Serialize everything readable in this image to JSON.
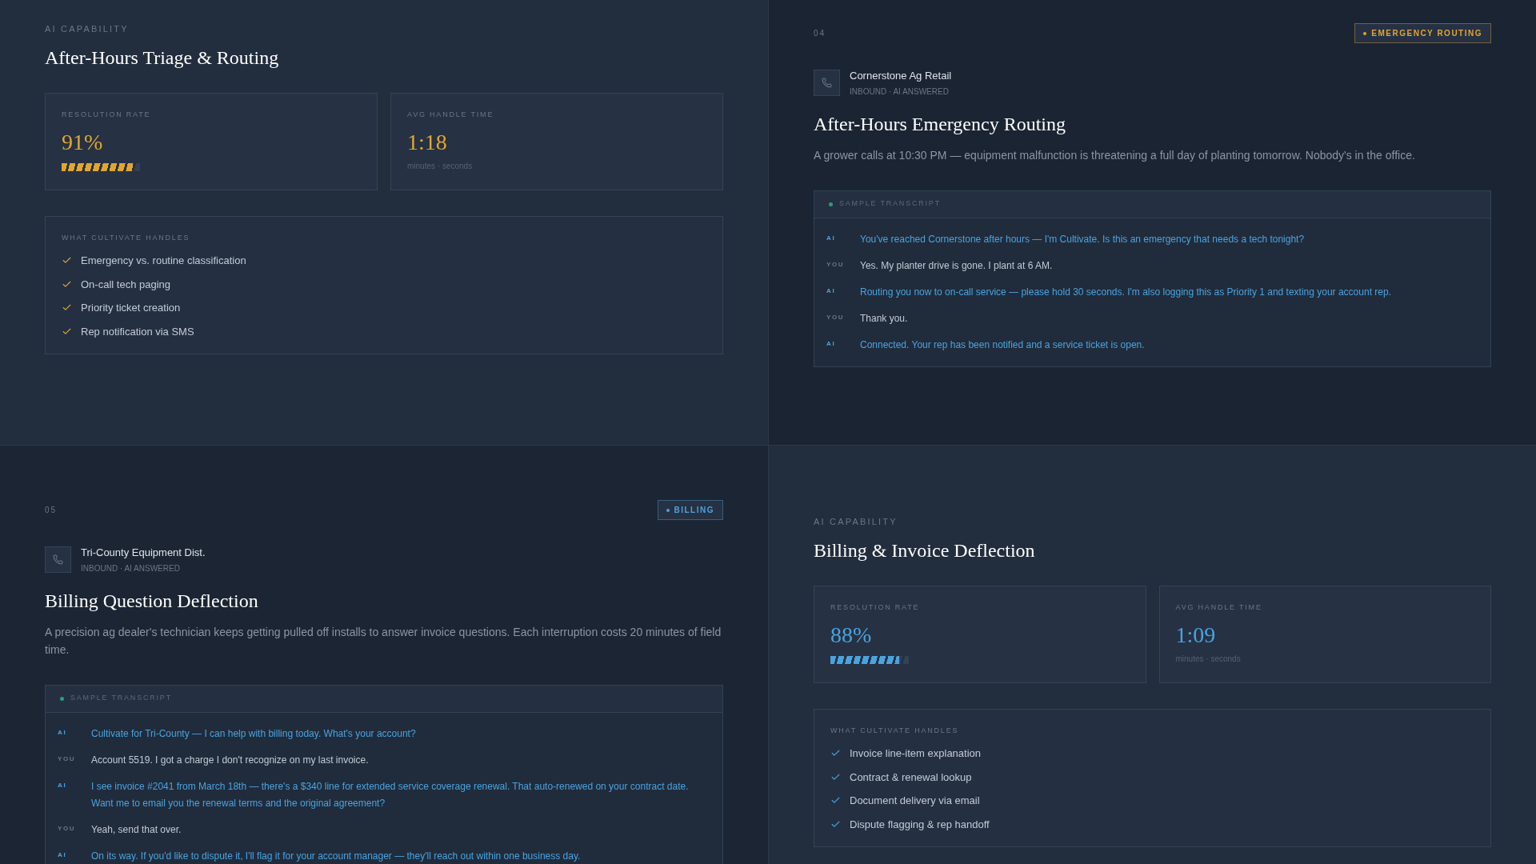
{
  "panels": [
    {
      "kind": "capability",
      "color": "#e0a630",
      "eyebrow": "AI CAPABILITY",
      "title": "After-Hours Triage & Routing",
      "metrics": [
        {
          "kind": "rate",
          "label": "RESOLUTION RATE",
          "value": "91%",
          "level": 0.91
        },
        {
          "kind": "time",
          "label": "AVG HANDLE TIME",
          "value": "1:18",
          "caption": "minutes · seconds"
        }
      ],
      "handles": {
        "heading": "WHAT CULTIVATE HANDLES",
        "items": [
          "Emergency vs. routine classification",
          "On-call tech paging",
          "Priority ticket creation",
          "Rep notification via SMS"
        ]
      }
    },
    {
      "kind": "scenario",
      "color": "#e0a630",
      "number": "04",
      "badge": "EMERGENCY ROUTING",
      "caller": {
        "name": "Cornerstone Ag Retail",
        "meta": "INBOUND · AI ANSWERED"
      },
      "title": "After-Hours Emergency Routing",
      "description": "A grower calls at 10:30 PM — equipment malfunction is threatening a full day of planting tomorrow. Nobody's in the office.",
      "transcript": {
        "heading": "SAMPLE TRANSCRIPT",
        "lines": [
          {
            "kind": "ai",
            "speaker": "AI",
            "text": "You've reached Cornerstone after hours — I'm Cultivate. Is this an emergency that needs a tech tonight?"
          },
          {
            "kind": "user",
            "speaker": "YOU",
            "text": "Yes. My planter drive is gone. I plant at 6 AM."
          },
          {
            "kind": "ai",
            "speaker": "AI",
            "text": "Routing you now to on-call service — please hold 30 seconds. I'm also logging this as Priority 1 and texting your account rep."
          },
          {
            "kind": "user",
            "speaker": "YOU",
            "text": "Thank you."
          },
          {
            "kind": "ai",
            "speaker": "AI",
            "text": "Connected. Your rep has been notified and a service ticket is open."
          }
        ]
      }
    },
    {
      "kind": "scenario",
      "color": "#4aa3df",
      "number": "05",
      "badge": "BILLING",
      "caller": {
        "name": "Tri-County Equipment Dist.",
        "meta": "INBOUND · AI ANSWERED"
      },
      "title": "Billing Question Deflection",
      "description": "A precision ag dealer's technician keeps getting pulled off installs to answer invoice questions. Each interruption costs 20 minutes of field time.",
      "transcript": {
        "heading": "SAMPLE TRANSCRIPT",
        "lines": [
          {
            "kind": "ai",
            "speaker": "AI",
            "text": "Cultivate for Tri-County — I can help with billing today. What's your account?"
          },
          {
            "kind": "user",
            "speaker": "YOU",
            "text": "Account 5519. I got a charge I don't recognize on my last invoice."
          },
          {
            "kind": "ai",
            "speaker": "AI",
            "text": "I see invoice #2041 from March 18th — there's a $340 line for extended service coverage renewal. That auto-renewed on your contract date. Want me to email you the renewal terms and the original agreement?"
          },
          {
            "kind": "user",
            "speaker": "YOU",
            "text": "Yeah, send that over."
          },
          {
            "kind": "ai",
            "speaker": "AI",
            "text": "On its way. If you'd like to dispute it, I'll flag it for your account manager — they'll reach out within one business day."
          }
        ]
      }
    },
    {
      "kind": "capability",
      "color": "#4aa3df",
      "eyebrow": "AI CAPABILITY",
      "title": "Billing & Invoice Deflection",
      "metrics": [
        {
          "kind": "rate",
          "label": "RESOLUTION RATE",
          "value": "88%",
          "level": 0.88
        },
        {
          "kind": "time",
          "label": "AVG HANDLE TIME",
          "value": "1:09",
          "caption": "minutes · seconds"
        }
      ],
      "handles": {
        "heading": "WHAT CULTIVATE HANDLES",
        "items": [
          "Invoice line-item explanation",
          "Contract & renewal lookup",
          "Document delivery via email",
          "Dispute flagging & rep handoff"
        ]
      }
    }
  ]
}
